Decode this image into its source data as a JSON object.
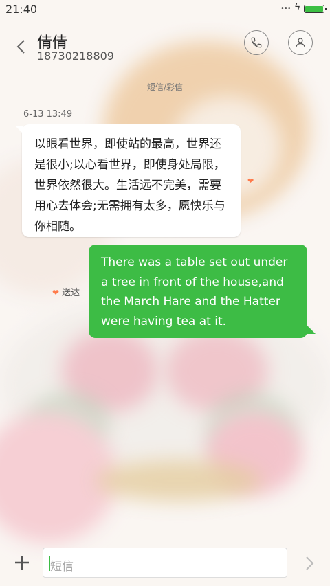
{
  "status_bar": {
    "time": "21:40",
    "battery_level": 1.0,
    "battery_color": "#3cbf43"
  },
  "header": {
    "contact_name": "倩倩",
    "phone_number": "18730218809"
  },
  "thread": {
    "divider_label": "短信/彩信",
    "messages": [
      {
        "direction": "incoming",
        "timestamp": "6-13 13:49",
        "text": "以眼看世界，即使站的最高，世界还是很小;以心看世界，即使身处局限，世界依然很大。生活远不完美，需要用心去体会;无需拥有太多，愿快乐与你相随。"
      },
      {
        "direction": "outgoing",
        "status": "送达",
        "text": "There was a table set out under a tree in front of the house,and the March Hare and the Hatter were having tea at it."
      }
    ]
  },
  "input": {
    "placeholder": "短信"
  },
  "colors": {
    "accent": "#3dbc45",
    "heart": "#ff7a4a"
  },
  "icons": {
    "back": "chevron-left-icon",
    "call": "phone-icon",
    "contact": "person-icon",
    "add": "plus-icon",
    "send": "chevron-right-icon"
  }
}
